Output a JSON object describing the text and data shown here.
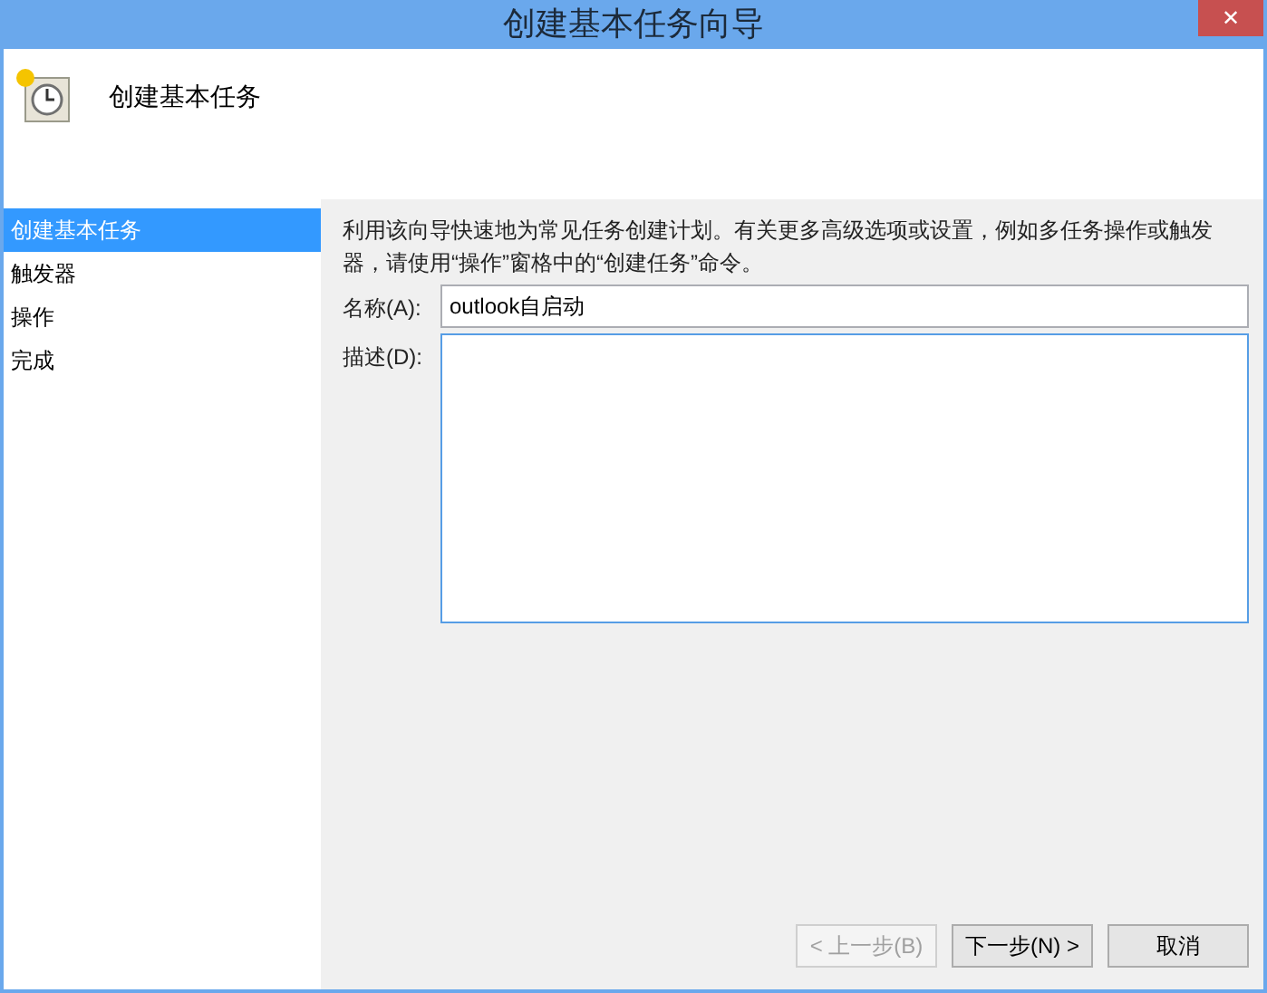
{
  "window": {
    "title": "创建基本任务向导",
    "close": "✕"
  },
  "header": {
    "title": "创建基本任务"
  },
  "sidebar": {
    "items": [
      {
        "label": "创建基本任务",
        "selected": true
      },
      {
        "label": "触发器",
        "selected": false
      },
      {
        "label": "操作",
        "selected": false
      },
      {
        "label": "完成",
        "selected": false
      }
    ]
  },
  "intro": "利用该向导快速地为常见任务创建计划。有关更多高级选项或设置，例如多任务操作或触发器，请使用“操作”窗格中的“创建任务”命令。",
  "fields": [
    {
      "label": "名称(A):",
      "value": "outlook自启动",
      "kind": "line"
    },
    {
      "label": "描述(D):",
      "kind": "area"
    }
  ],
  "buttons": [
    {
      "label": "< 上一步(B)",
      "disabled": true
    },
    {
      "label": "下一步(N) >",
      "disabled": false
    },
    {
      "label": "取消",
      "disabled": false
    }
  ]
}
